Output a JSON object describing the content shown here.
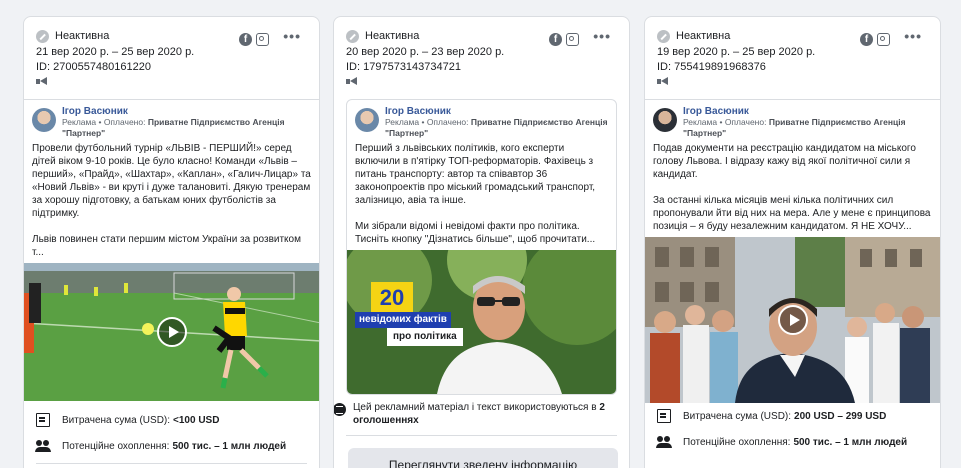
{
  "cards": [
    {
      "status": "Неактивна",
      "dates": "21 вер 2020 р. – 25 вер 2020 р.",
      "id": "ID: 2700557480161220",
      "page_name": "Ігор Васюник",
      "sponsor_prefix": "Реклама •",
      "sponsor_paid": "Оплачено:",
      "sponsor_name": "Приватне Підприємство Агенція \"Партнер\"",
      "body": [
        "Провели футбольний турнір «ЛЬВІВ - ПЕРШИЙ!» серед дітей віком 9-10 років. Це було класно! Команди «Львів – перший», «Прайд», «Шахтар», «Каплан», «Галич-Лицар» та «Новий Львів» - ви круті і дуже талановиті. Дякую тренерам за хорошу підготовку, а батькам юних футболістів за підтримку.",
        "Львів повинен стати першим містом України за розвитком т..."
      ],
      "spend_label": "Витрачена сума (USD):",
      "spend_value": "<100 USD",
      "reach_label": "Потенційне охоплення:",
      "reach_value": "500 тис. – 1 млн людей"
    },
    {
      "status": "Неактивна",
      "dates": "20 вер 2020 р. – 23 вер 2020 р.",
      "id": "ID: 1797573143734721",
      "page_name": "Ігор Васюник",
      "sponsor_prefix": "Реклама •",
      "sponsor_paid": "Оплачено:",
      "sponsor_name": "Приватне Підприємство Агенція \"Партнер\"",
      "body": [
        "Перший з львівських політиків, кого експерти включили в п'ятірку ТОП-реформаторів. Фахівець з питань транспорту: автор та співавтор 36 законопроектів про міський громадський транспорт, залізницю, авіа та інше.",
        "Ми зібрали відомі і невідомі факти про політика. Тисніть кнопку \"Дізнатись більше\", щоб прочитати..."
      ],
      "banner_number": "20",
      "banner_line1": "невідомих фактів",
      "banner_line2": "про політика",
      "notice_text": "Цей рекламний матеріал і текст використовуються в",
      "notice_count": "2 оголошеннях",
      "summary_button": "Переглянути зведену інформацію"
    },
    {
      "status": "Неактивна",
      "dates": "19 вер 2020 р. – 25 вер 2020 р.",
      "id": "ID: 755419891968376",
      "page_name": "Ігор Васюник",
      "sponsor_prefix": "Реклама •",
      "sponsor_paid": "Оплачено:",
      "sponsor_name": "Приватне Підприємство Агенція \"Партнер\"",
      "body": [
        "Подав документи на реєстрацію кандидатом на міського голову Львова. І відразу кажу від якої політичної сили я кандидат.",
        "За останні кілька місяців мені кілька політичних сил пропонували йти від них на мера. Але у мене є принципова позиція – я буду незалежним кандидатом. Я НЕ ХОЧУ..."
      ],
      "spend_label": "Витрачена сума (USD):",
      "spend_value": "200 USD – 299 USD",
      "reach_label": "Потенційне охоплення:",
      "reach_value": "500 тис. – 1 млн людей"
    }
  ],
  "colors": {
    "link": "#385898",
    "border": "#dadde1",
    "banner_yellow": "#f5d414",
    "banner_blue": "#1f3fb0"
  },
  "icons": [
    "inactive-status-icon",
    "facebook-icon",
    "instagram-icon",
    "more-options-icon",
    "megaphone-icon",
    "play-icon",
    "bill-icon",
    "people-icon",
    "stack-icon"
  ]
}
